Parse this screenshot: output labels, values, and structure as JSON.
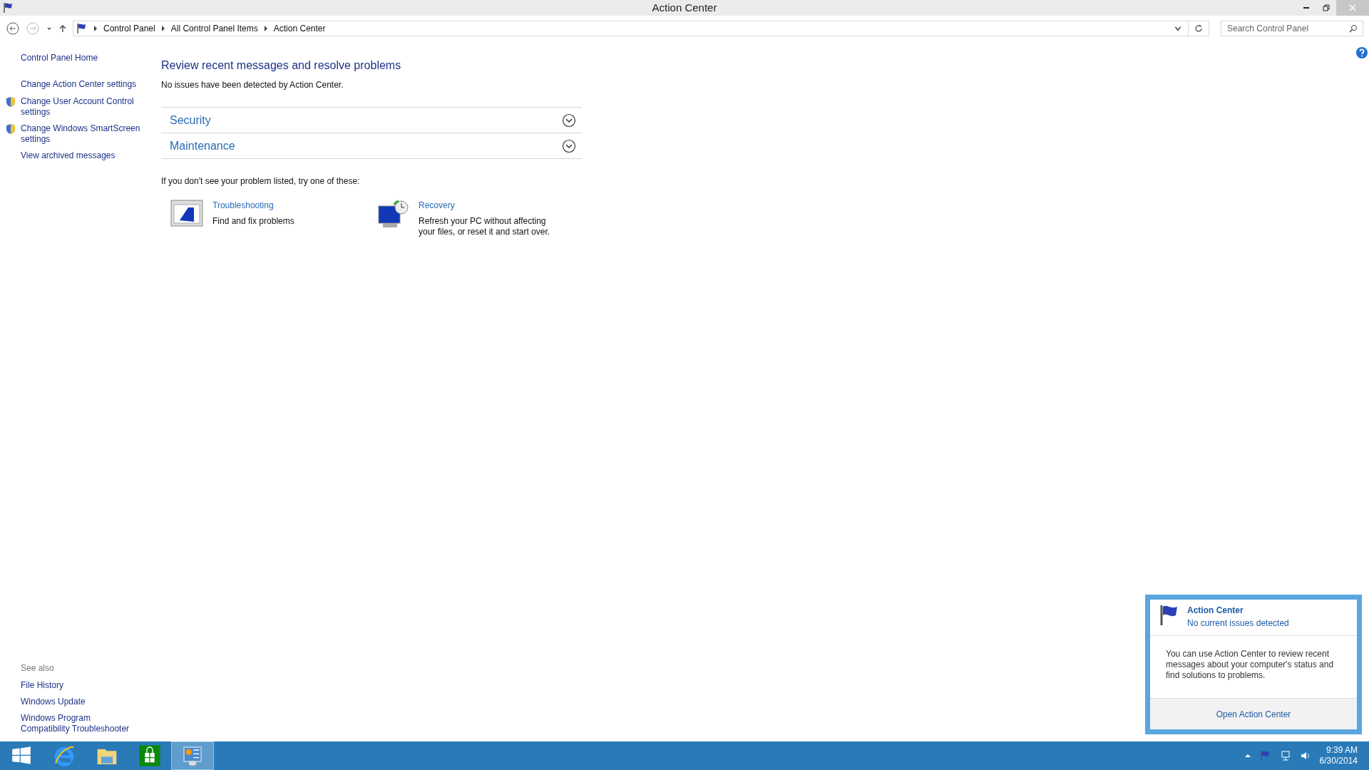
{
  "window": {
    "title": "Action Center"
  },
  "address_bar": {
    "crumbs": [
      "Control Panel",
      "All Control Panel Items",
      "Action Center"
    ]
  },
  "search": {
    "placeholder": "Search Control Panel"
  },
  "sidebar": {
    "home": "Control Panel Home",
    "links": [
      {
        "label": "Change Action Center settings",
        "shield": false
      },
      {
        "label": "Change User Account Control settings",
        "shield": true
      },
      {
        "label": "Change Windows SmartScreen settings",
        "shield": true
      },
      {
        "label": "View archived messages",
        "shield": false
      }
    ],
    "see_also": {
      "heading": "See also",
      "links": [
        "File History",
        "Windows Update",
        "Windows Program Compatibility Troubleshooter"
      ]
    }
  },
  "main": {
    "heading": "Review recent messages and resolve problems",
    "status": "No issues have been detected by Action Center.",
    "sections": [
      {
        "label": "Security",
        "expanded": false
      },
      {
        "label": "Maintenance",
        "expanded": false
      }
    ],
    "hint": "If you don't see your problem listed, try one of these:",
    "tools": [
      {
        "kind": "troubleshooting",
        "title": "Troubleshooting",
        "description": "Find and fix problems"
      },
      {
        "kind": "recovery",
        "title": "Recovery",
        "description": "Refresh your PC without affecting your files, or reset it and start over."
      }
    ]
  },
  "flyout": {
    "title": "Action Center",
    "subtitle": "No current issues detected",
    "body": "You can use Action Center to review recent messages about your computer's status and find solutions to problems.",
    "link": "Open Action Center"
  },
  "taskbar": {
    "apps": [
      {
        "kind": "start",
        "selected": false
      },
      {
        "kind": "browser",
        "selected": false
      },
      {
        "kind": "folder",
        "selected": false
      },
      {
        "kind": "store",
        "selected": false
      },
      {
        "kind": "control-panel",
        "selected": true
      }
    ],
    "time": "9:39 AM",
    "date": "6/30/2014"
  }
}
